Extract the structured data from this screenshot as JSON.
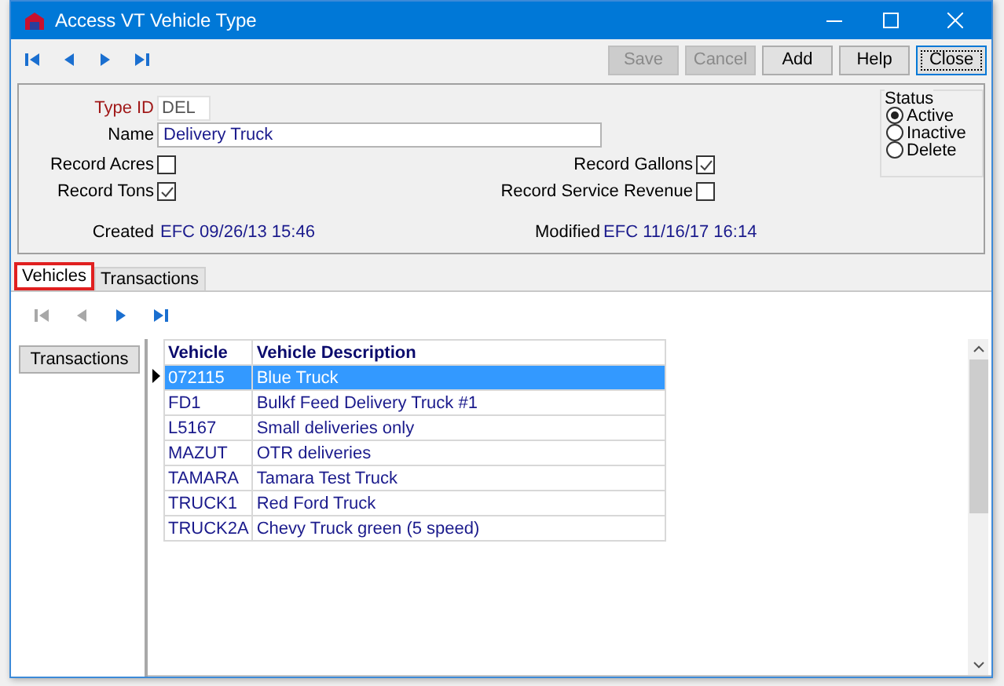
{
  "window": {
    "title": "Access VT Vehicle Type"
  },
  "toolbar": {
    "nav": [
      {
        "kind": "first",
        "disabled": false
      },
      {
        "kind": "prev",
        "disabled": false
      },
      {
        "kind": "next",
        "disabled": false
      },
      {
        "kind": "last",
        "disabled": false
      }
    ],
    "buttons": [
      {
        "label": "Save",
        "disabled": true,
        "focused": false
      },
      {
        "label": "Cancel",
        "disabled": true,
        "focused": false
      },
      {
        "label": "Add",
        "disabled": false,
        "focused": false
      },
      {
        "label": "Help",
        "disabled": false,
        "focused": false
      },
      {
        "label": "Close",
        "disabled": false,
        "focused": true
      }
    ]
  },
  "form": {
    "type_id": {
      "label": "Type ID",
      "value": "DEL"
    },
    "name": {
      "label": "Name",
      "value": "Delivery Truck"
    },
    "left_checkboxes": [
      {
        "label": "Record Acres",
        "checked": false
      },
      {
        "label": "Record Tons",
        "checked": true
      }
    ],
    "right_checkboxes": [
      {
        "label": "Record Gallons",
        "checked": true
      },
      {
        "label": "Record Service Revenue",
        "checked": false
      }
    ],
    "created": {
      "label": "Created",
      "value": "EFC 09/26/13 15:46"
    },
    "modified": {
      "label": "Modified",
      "value": "EFC 11/16/17 16:14"
    }
  },
  "status": {
    "title": "Status",
    "options": [
      {
        "label": "Active",
        "selected": true
      },
      {
        "label": "Inactive",
        "selected": false
      },
      {
        "label": "Delete",
        "selected": false
      }
    ]
  },
  "tabs": [
    {
      "label": "Vehicles",
      "selected": true
    },
    {
      "label": "Transactions",
      "selected": false
    }
  ],
  "tab_nav": [
    {
      "kind": "first",
      "disabled": true
    },
    {
      "kind": "prev",
      "disabled": true
    },
    {
      "kind": "next",
      "disabled": false
    },
    {
      "kind": "last",
      "disabled": false
    }
  ],
  "side_button": "Transactions",
  "table": {
    "columns": [
      "Vehicle",
      "Vehicle Description"
    ],
    "rows": [
      {
        "cells": [
          "072115",
          "Blue Truck"
        ],
        "selected": true
      },
      {
        "cells": [
          "FD1",
          "Bulkf Feed Delivery Truck #1"
        ],
        "selected": false
      },
      {
        "cells": [
          "L5167",
          "Small deliveries only"
        ],
        "selected": false
      },
      {
        "cells": [
          "MAZUT",
          "OTR deliveries"
        ],
        "selected": false
      },
      {
        "cells": [
          "TAMARA",
          "Tamara Test Truck"
        ],
        "selected": false
      },
      {
        "cells": [
          "TRUCK1",
          "Red Ford Truck"
        ],
        "selected": false
      },
      {
        "cells": [
          "TRUCK2A",
          "Chevy Truck green (5 speed)"
        ],
        "selected": false
      }
    ]
  }
}
